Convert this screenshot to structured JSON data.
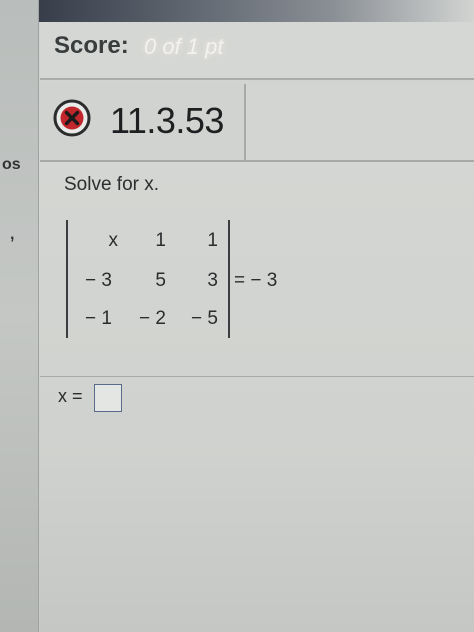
{
  "left_panel": {
    "fragment_1": "os",
    "fragment_2": ","
  },
  "score": {
    "label": "Score:",
    "value": "0 of 1 pt"
  },
  "question": {
    "status_icon": "x-circle-icon",
    "id": "11.3.53",
    "prompt": "Solve for x."
  },
  "determinant": {
    "rows": [
      [
        "x",
        "1",
        "1"
      ],
      [
        "− 3",
        "5",
        "3"
      ],
      [
        "− 1",
        "− 2",
        "− 5"
      ]
    ],
    "equals_text": "= − 3"
  },
  "answer": {
    "label": "x =",
    "value": ""
  },
  "colors": {
    "error_red": "#c0262c"
  }
}
